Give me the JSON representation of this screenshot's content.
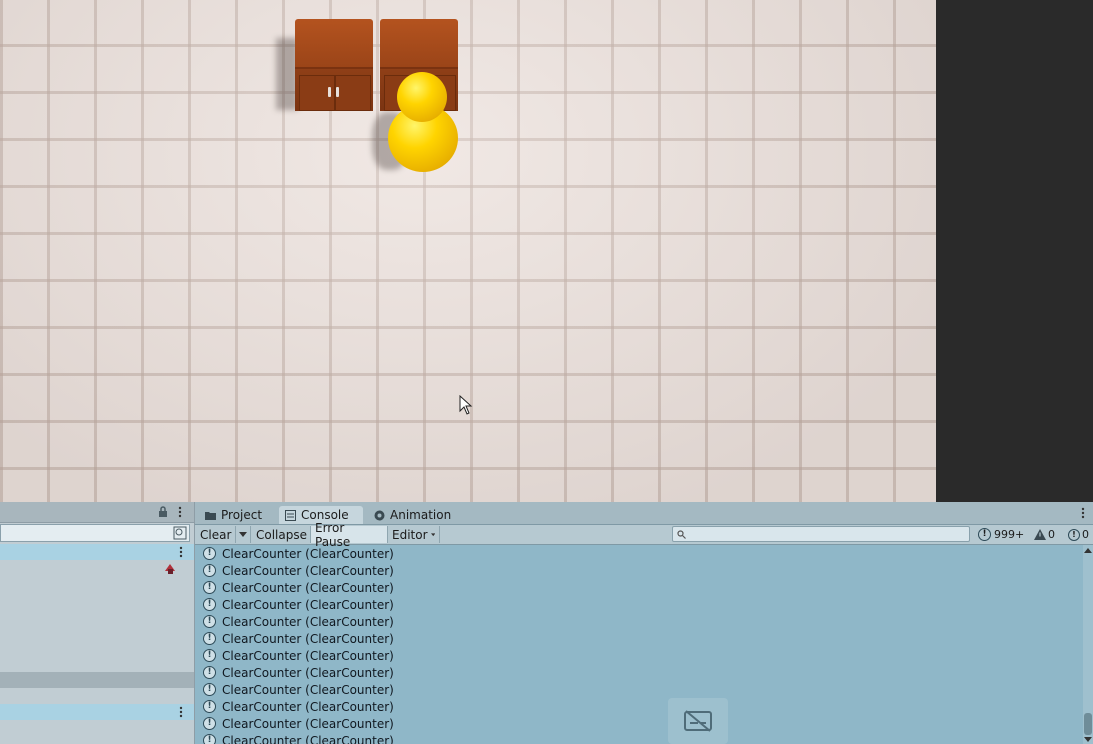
{
  "tabs": [
    {
      "label": "Project",
      "icon": "folder-icon"
    },
    {
      "label": "Console",
      "icon": "console-icon",
      "active": true
    },
    {
      "label": "Animation",
      "icon": "animation-icon"
    }
  ],
  "toolbar": {
    "clear_label": "Clear",
    "collapse_label": "Collapse",
    "error_pause_label": "Error Pause",
    "editor_label": "Editor",
    "search_placeholder": ""
  },
  "counts": {
    "info": "999+",
    "warnings": "0",
    "errors": "0"
  },
  "log_entries": [
    "ClearCounter (ClearCounter)",
    "ClearCounter (ClearCounter)",
    "ClearCounter (ClearCounter)",
    "ClearCounter (ClearCounter)",
    "ClearCounter (ClearCounter)",
    "ClearCounter (ClearCounter)",
    "ClearCounter (ClearCounter)",
    "ClearCounter (ClearCounter)",
    "ClearCounter (ClearCounter)",
    "ClearCounter (ClearCounter)",
    "ClearCounter (ClearCounter)",
    "ClearCounter (ClearCounter)"
  ],
  "colors": {
    "console_bg": "#8fb7c8",
    "counter_wood": "#9a4418",
    "player_yellow": "#ffd400"
  }
}
